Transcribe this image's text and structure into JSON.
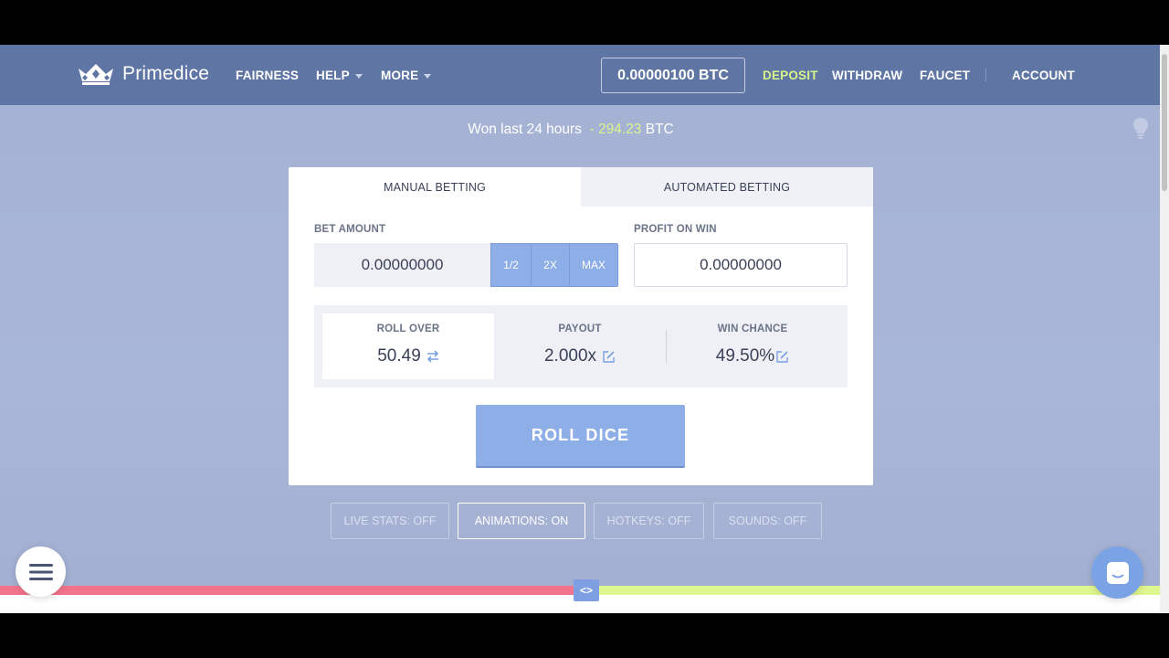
{
  "nav": {
    "brand": "Primedice",
    "links": {
      "fairness": "FAIRNESS",
      "help": "HELP",
      "more": "MORE",
      "deposit": "DEPOSIT",
      "withdraw": "WITHDRAW",
      "faucet": "FAUCET",
      "account": "ACCOUNT"
    },
    "balance": "0.00000100 BTC"
  },
  "banner": {
    "prefix": "Won last 24 hours",
    "dash": "-",
    "amount": "294.23",
    "currency": "BTC"
  },
  "tabs": {
    "manual": "MANUAL BETTING",
    "automated": "AUTOMATED BETTING"
  },
  "bet": {
    "label": "BET AMOUNT",
    "value": "0.00000000",
    "half": "1/2",
    "double": "2X",
    "max": "MAX"
  },
  "profit": {
    "label": "PROFIT ON WIN",
    "value": "0.00000000"
  },
  "stats": {
    "roll_over": {
      "label": "ROLL OVER",
      "value": "50.49"
    },
    "payout": {
      "label": "PAYOUT",
      "value": "2.000x"
    },
    "win_chance": {
      "label": "WIN CHANCE",
      "value": "49.50%"
    }
  },
  "roll_button": "ROLL DICE",
  "toggles": {
    "live_stats": "LIVE STATS: OFF",
    "animations": "ANIMATIONS: ON",
    "hotkeys": "HOTKEYS: OFF",
    "sounds": "SOUNDS: OFF"
  },
  "slider_handle": "<>",
  "colors": {
    "nav": "#5f75a4",
    "accent": "#8eaee8",
    "won": "#d9f58e",
    "red_bar": "#f2738c",
    "green_bar": "#dff58d"
  }
}
